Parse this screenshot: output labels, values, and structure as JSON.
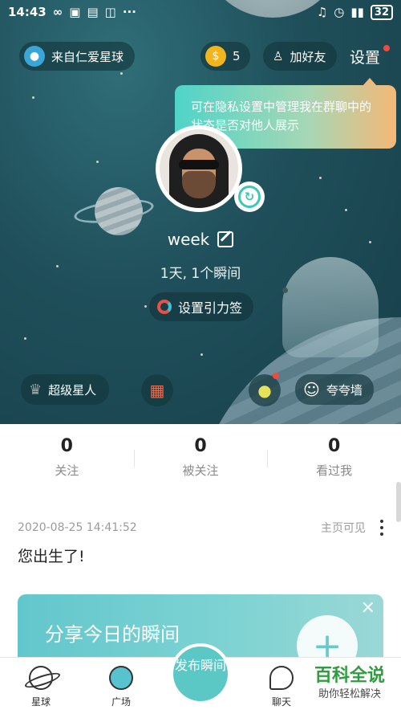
{
  "status_bar": {
    "time": "14:43",
    "battery": "32"
  },
  "header": {
    "origin_label": "来自仁爱星球",
    "coins": "5",
    "add_friend_label": "加好友",
    "settings_label": "设置"
  },
  "tooltip": {
    "text": "可在隐私设置中管理我在群聊中的状态是否对他人展示"
  },
  "profile": {
    "username": "week",
    "days_moments": "1天, 1个瞬间",
    "gravity_label": "设置引力签",
    "super_label": "超级星人",
    "praise_label": "夸夸墙"
  },
  "stats": [
    {
      "num": "0",
      "label": "关注"
    },
    {
      "num": "0",
      "label": "被关注"
    },
    {
      "num": "0",
      "label": "看过我"
    }
  ],
  "post": {
    "timestamp": "2020-08-25 14:41:52",
    "visibility": "主页可见",
    "text": "您出生了!"
  },
  "share_card": {
    "title": "分享今日的瞬间",
    "close": "×",
    "plus": "+"
  },
  "bottom_nav": {
    "planet": "星球",
    "square": "广场",
    "publish": "发布瞬间",
    "chat": "聊天"
  },
  "watermark": {
    "title": "百科全说",
    "subtitle": "助你轻松解决"
  },
  "colors": {
    "accent": "#5cc8c6",
    "hero_bg": "#1f4f5a",
    "notify": "#f04a3e"
  }
}
